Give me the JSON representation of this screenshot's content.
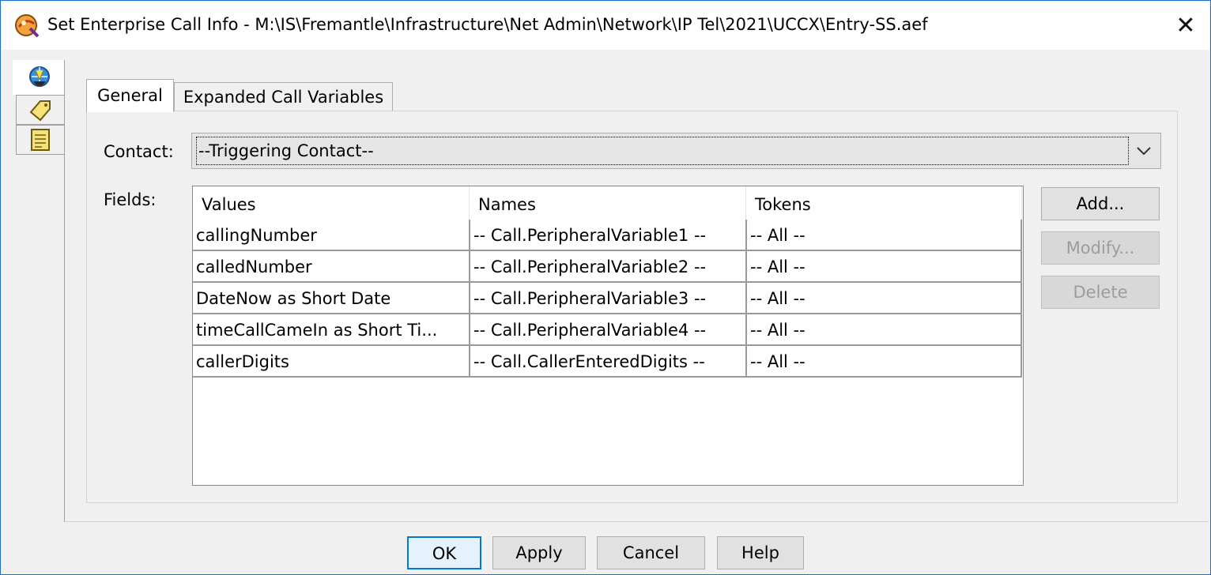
{
  "window": {
    "title": "Set Enterprise Call Info - M:\\IS\\Fremantle\\Infrastructure\\Net Admin\\Network\\IP Tel\\2021\\UCCX\\Entry-SS.aef",
    "close_glyph": "✕"
  },
  "side_tabs": [
    {
      "icon": "phone-globe-icon"
    },
    {
      "icon": "tag-icon"
    },
    {
      "icon": "notepad-icon"
    }
  ],
  "tabs": {
    "general": "General",
    "expanded": "Expanded Call Variables"
  },
  "contact": {
    "label": "Contact:",
    "value": "--Triggering Contact--"
  },
  "fields": {
    "label": "Fields:",
    "columns": [
      "Values",
      "Names",
      "Tokens"
    ],
    "rows": [
      [
        "callingNumber",
        "-- Call.PeripheralVariable1 --",
        "-- All --"
      ],
      [
        "calledNumber",
        "-- Call.PeripheralVariable2 --",
        "-- All --"
      ],
      [
        "DateNow as Short Date",
        "-- Call.PeripheralVariable3 --",
        "-- All --"
      ],
      [
        "timeCallCameIn as Short Ti...",
        "-- Call.PeripheralVariable4 --",
        "-- All --"
      ],
      [
        "callerDigits",
        "-- Call.CallerEnteredDigits --",
        "-- All --"
      ]
    ]
  },
  "side_buttons": {
    "add": "Add...",
    "modify": "Modify...",
    "delete": "Delete"
  },
  "footer": {
    "ok": "OK",
    "apply": "Apply",
    "cancel": "Cancel",
    "help": "Help"
  },
  "colors": {
    "accent": "#0078d7",
    "window_bg": "#f0f0f0"
  }
}
